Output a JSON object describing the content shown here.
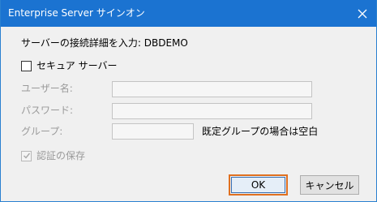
{
  "window": {
    "title": "Enterprise Server サインオン",
    "close_icon": "close-icon"
  },
  "form": {
    "connection_detail_label": "サーバーの接続詳細を入力: DBDEMO",
    "secure_server_label": "セキュア サーバー",
    "secure_server_checked": false,
    "username_label": "ユーザー名:",
    "username_value": "",
    "password_label": "パスワード:",
    "password_value": "",
    "group_label": "グループ:",
    "group_value": "",
    "group_hint": "既定グループの場合は空白",
    "save_auth_label": "認証の保存",
    "save_auth_checked": true
  },
  "buttons": {
    "ok_label": "OK",
    "cancel_label": "キャンセル"
  },
  "colors": {
    "titlebar": "#1b73d1",
    "default_button_border": "#e07020",
    "disabled_text": "#9a9a9a"
  }
}
